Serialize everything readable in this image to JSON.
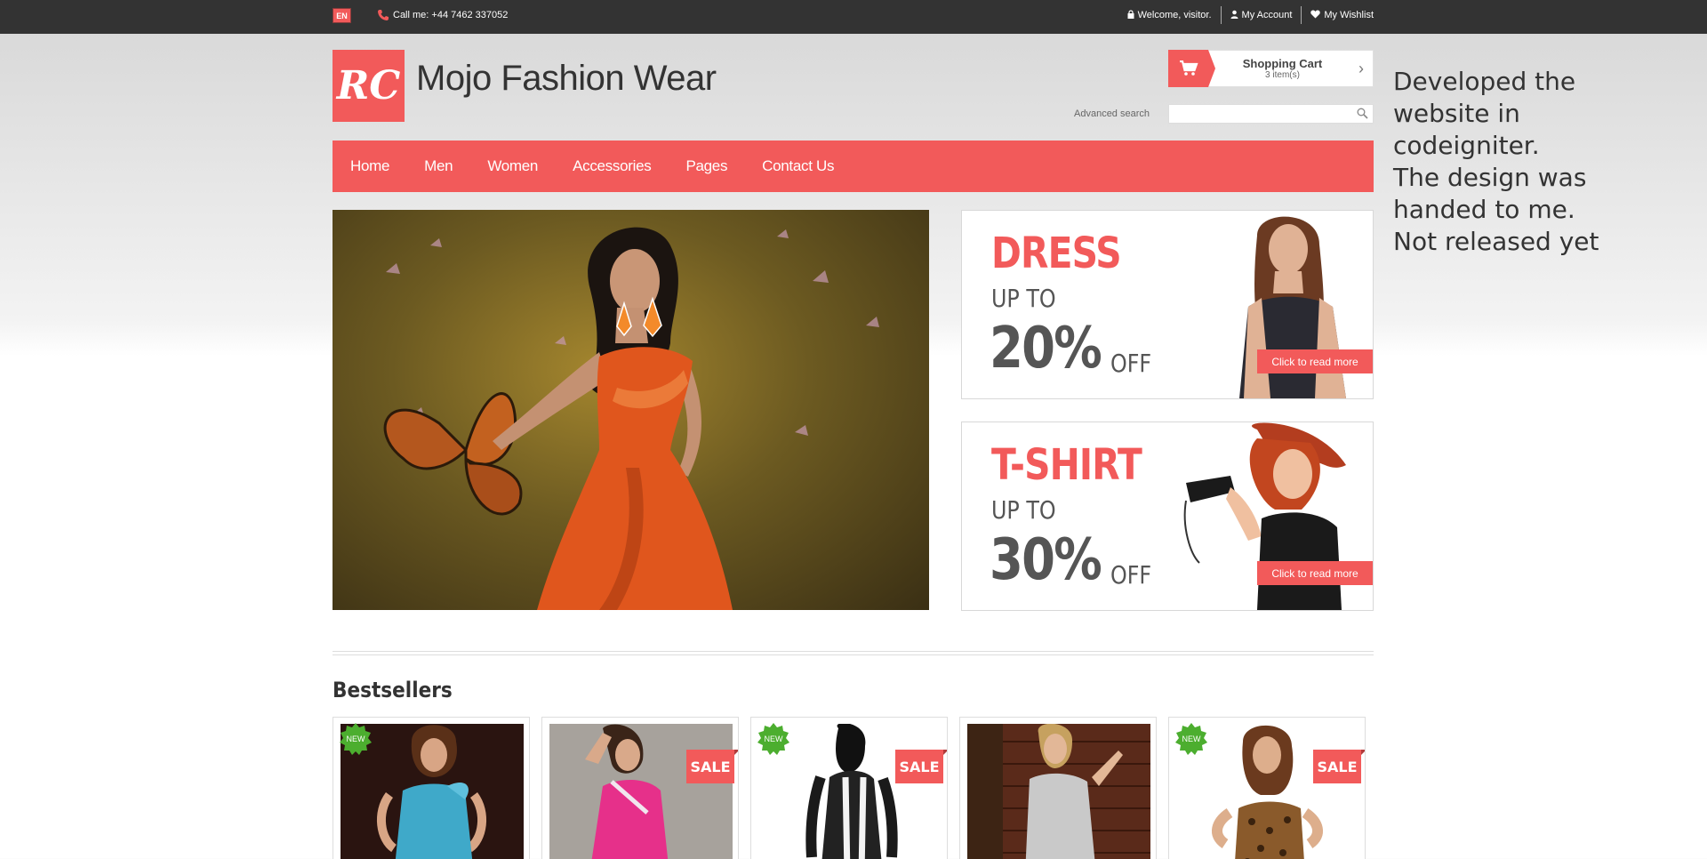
{
  "topbar": {
    "language": "EN",
    "call_text": "Call me: +44 7462 337052",
    "welcome": "Welcome, visitor.",
    "my_account": "My Account",
    "my_wishlist": "My Wishlist"
  },
  "header": {
    "logo_text": "RC",
    "site_title": "Mojo Fashion Wear",
    "cart_title": "Shopping Cart",
    "cart_items": "3 item(s)",
    "advanced_search": "Advanced search",
    "search_placeholder": ""
  },
  "nav": {
    "items": [
      "Home",
      "Men",
      "Women",
      "Accessories",
      "Pages",
      "Contact Us"
    ]
  },
  "side_note": {
    "lines": [
      "Developed the",
      "website in",
      "codeigniter.",
      "The design was",
      "handed to me.",
      "Not released yet"
    ]
  },
  "promos": [
    {
      "title": "DRESS",
      "upto": "UP TO",
      "percent": "20%",
      "off": "OFF",
      "cta": "Click to read more"
    },
    {
      "title": "T-SHIRT",
      "upto": "UP TO",
      "percent": "30%",
      "off": "OFF",
      "cta": "Click to read more"
    }
  ],
  "bestsellers": {
    "heading": "Bestsellers",
    "products": [
      {
        "badge": "NEW",
        "dress_color": "#3fa9c9"
      },
      {
        "badge": "SALE",
        "dress_color": "#e6308a"
      },
      {
        "badge_new": "NEW",
        "badge": "SALE",
        "dress_color": "#222222"
      },
      {
        "badge": "",
        "dress_color": "#c9c9c9"
      },
      {
        "badge_new": "NEW",
        "badge": "SALE",
        "dress_color": "#8a5a2b"
      }
    ]
  },
  "colors": {
    "accent": "#f25a5a",
    "topbar": "#333333",
    "new_badge": "#4cae2f"
  }
}
